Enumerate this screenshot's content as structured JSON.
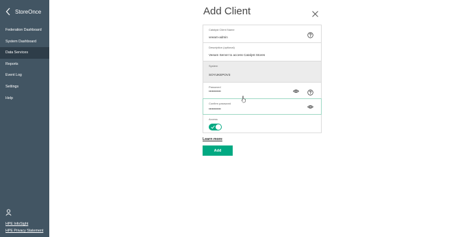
{
  "app": {
    "brand": "StoreOnce"
  },
  "sidebar": {
    "items": [
      {
        "label": "Federation Dashboard",
        "active": false
      },
      {
        "label": "System Dashboard",
        "active": false
      },
      {
        "label": "Data Services",
        "active": true
      },
      {
        "label": "Reports",
        "active": false
      },
      {
        "label": "Event Log",
        "active": false
      },
      {
        "label": "Settings",
        "active": false
      },
      {
        "label": "Help",
        "active": false
      }
    ],
    "footer_links": [
      "HPE InfoSight",
      "HPE Privacy Statement"
    ]
  },
  "dialog": {
    "title": "Add Client",
    "fields": {
      "client_name": {
        "label": "Catalyst Client Name",
        "value": "veeam-admin"
      },
      "description": {
        "label": "Description (optional)",
        "value": "Veeam Server to access Catalyst Stores"
      },
      "system": {
        "label": "System",
        "value": "SOYUKEPOV3"
      },
      "password": {
        "label": "Password",
        "value": "•••••••••••"
      },
      "confirm_password": {
        "label": "Confirm password",
        "value": "•••••••••••"
      },
      "access": {
        "label": "Access",
        "enabled": true
      }
    },
    "learn_more": "Learn more",
    "add_button": "Add"
  },
  "colors": {
    "sidebar_bg": "#425563",
    "sidebar_active": "#2e3d49",
    "accent": "#01a982",
    "focus_border": "#9ed8c4"
  },
  "icons": [
    "chevron-left-icon",
    "close-icon",
    "help-icon",
    "eye-icon",
    "checkmark-icon",
    "user-icon",
    "mouse-pointer-icon"
  ]
}
